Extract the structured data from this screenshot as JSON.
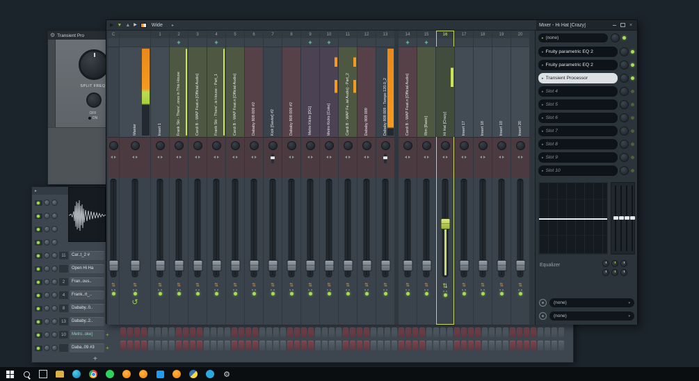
{
  "desktop": {
    "bg_color": "#1b232b"
  },
  "colors": {
    "accent_selected": "#c9da6b",
    "meter_orange": "#f59a20",
    "meter_green": "#cde35a",
    "led_green": "#a8e052",
    "arm_teal": "#6fd0b2",
    "fl_orange": "#f7941e"
  },
  "transient_window": {
    "title": "Transient Pro",
    "split_freq_label": "SPLIT FREQ",
    "off_label": "OFF",
    "on_label": "ON"
  },
  "mixer": {
    "title": "Mixer - Hi Hat [Crazy]",
    "layout_mode": "Wide",
    "selected_track": "16",
    "tracks": [
      {
        "num": "C",
        "name": "",
        "color": "dark",
        "width": 16
      },
      {
        "num": "",
        "name": "Master",
        "color": "default",
        "width": 44,
        "meter": {
          "kind": "master",
          "width": 11
        },
        "link_icon": true
      },
      {
        "num": "1",
        "name": "Insert 1",
        "color": "default"
      },
      {
        "num": "2",
        "name": "Frank Ski - There'..ores in This House",
        "color": "green",
        "armed": true,
        "meter": {
          "kind": "thin",
          "width": 2
        }
      },
      {
        "num": "3",
        "name": "Cardi B - WAP Feat.n [Official Audio]",
        "color": "green"
      },
      {
        "num": "4",
        "name": "Frank Ski - There'..is House - Part_1",
        "color": "green",
        "armed": true,
        "meter": {
          "kind": "thin",
          "width": 2
        }
      },
      {
        "num": "5",
        "name": "Cardi B - WAP Feat.n [Official Audio]",
        "color": "green"
      },
      {
        "num": "6",
        "name": "Dababy 808 009 #2",
        "color": "maroon"
      },
      {
        "num": "7",
        "name": "Kick [Savior] #2",
        "color": "dark",
        "sep_slider": true
      },
      {
        "num": "8",
        "name": "Dababy 808 009 #2",
        "color": "maroon"
      },
      {
        "num": "9",
        "name": "Metro Kicks [DG]",
        "color": "purple",
        "armed": true
      },
      {
        "num": "10",
        "name": "Metro Kicks [Coke]",
        "color": "purple",
        "armed": true,
        "meter": {
          "kind": "blips",
          "width": 4
        }
      },
      {
        "num": "11",
        "name": "Cardi B - WAP Fe..ial Audio] - Part_2",
        "color": "green",
        "meter": {
          "kind": "blips",
          "width": 4
        }
      },
      {
        "num": "12",
        "name": "Dababy 808 009",
        "color": "maroon"
      },
      {
        "num": "13",
        "name": "Dababy 808 009 - Tempo 120.0_2",
        "color": "dark",
        "meter": {
          "kind": "solid",
          "width": 9
        },
        "sep_slider": true
      },
      {
        "num": "14",
        "name": "Cardi B - WAP Feat.n [Official Audio]",
        "color": "maroon",
        "armed": true,
        "gap_before": true
      },
      {
        "num": "15",
        "name": "Rim [Basic]",
        "color": "green",
        "armed": true
      },
      {
        "num": "16",
        "name": "Hi Hat [Crazy]",
        "color": "selected",
        "selected": true,
        "fader_pos": 0.45,
        "meter": {
          "kind": "blipgreen",
          "width": 4
        }
      },
      {
        "num": "17",
        "name": "Insert 17",
        "color": "default"
      },
      {
        "num": "18",
        "name": "Insert 18",
        "color": "default"
      },
      {
        "num": "19",
        "name": "Insert 19",
        "color": "default"
      },
      {
        "num": "20",
        "name": "Insert 20",
        "color": "default"
      }
    ]
  },
  "effects_panel": {
    "preset_selector": "(none)",
    "slots": [
      {
        "label": "Fruity parametric EQ 2",
        "filled": true,
        "enabled": true
      },
      {
        "label": "Fruity parametric EQ 2",
        "filled": true,
        "enabled": true
      },
      {
        "label": "Transient Processor",
        "filled": true,
        "enabled": true,
        "selected": true
      },
      {
        "label": "Slot 4"
      },
      {
        "label": "Slot 5"
      },
      {
        "label": "Slot 6"
      },
      {
        "label": "Slot 7"
      },
      {
        "label": "Slot 8"
      },
      {
        "label": "Slot 9"
      },
      {
        "label": "Slot 10"
      }
    ],
    "equalizer_label": "Equalizer",
    "send_slots": [
      {
        "label": "(none)"
      },
      {
        "label": "(none)"
      }
    ]
  },
  "channel_rack": {
    "add_button_label": "+",
    "rows": [
      {
        "num": "",
        "name": ""
      },
      {
        "num": "",
        "name": ""
      },
      {
        "num": "",
        "name": ""
      },
      {
        "num": "",
        "name": ""
      },
      {
        "num": "11",
        "name": "Car..t_2 #"
      },
      {
        "num": "",
        "name": "Open Hi Ha"
      },
      {
        "num": "2",
        "name": "Fran..ous.."
      },
      {
        "num": "4",
        "name": "Frank..rt_.."
      },
      {
        "num": "8",
        "name": "Dababy..0.."
      },
      {
        "num": "13",
        "name": "Dababy..2.."
      },
      {
        "num": "10",
        "name": "Metro..oke]",
        "plus": true,
        "accent": true
      },
      {
        "num": "",
        "name": "Daba..09 #3",
        "plus": true
      }
    ],
    "step_pattern": {
      "cells_per_row": 64,
      "group_size": 4,
      "rows": 2
    }
  },
  "taskbar": {
    "items": [
      {
        "name": "start"
      },
      {
        "name": "search"
      },
      {
        "name": "task-view"
      },
      {
        "name": "file-explorer"
      },
      {
        "name": "edge"
      },
      {
        "name": "chrome"
      },
      {
        "name": "whatsapp"
      },
      {
        "name": "fl-studio"
      },
      {
        "name": "fl-studio"
      },
      {
        "name": "vscode"
      },
      {
        "name": "fl-studio"
      },
      {
        "name": "python"
      },
      {
        "name": "telegram"
      },
      {
        "name": "settings"
      }
    ]
  }
}
